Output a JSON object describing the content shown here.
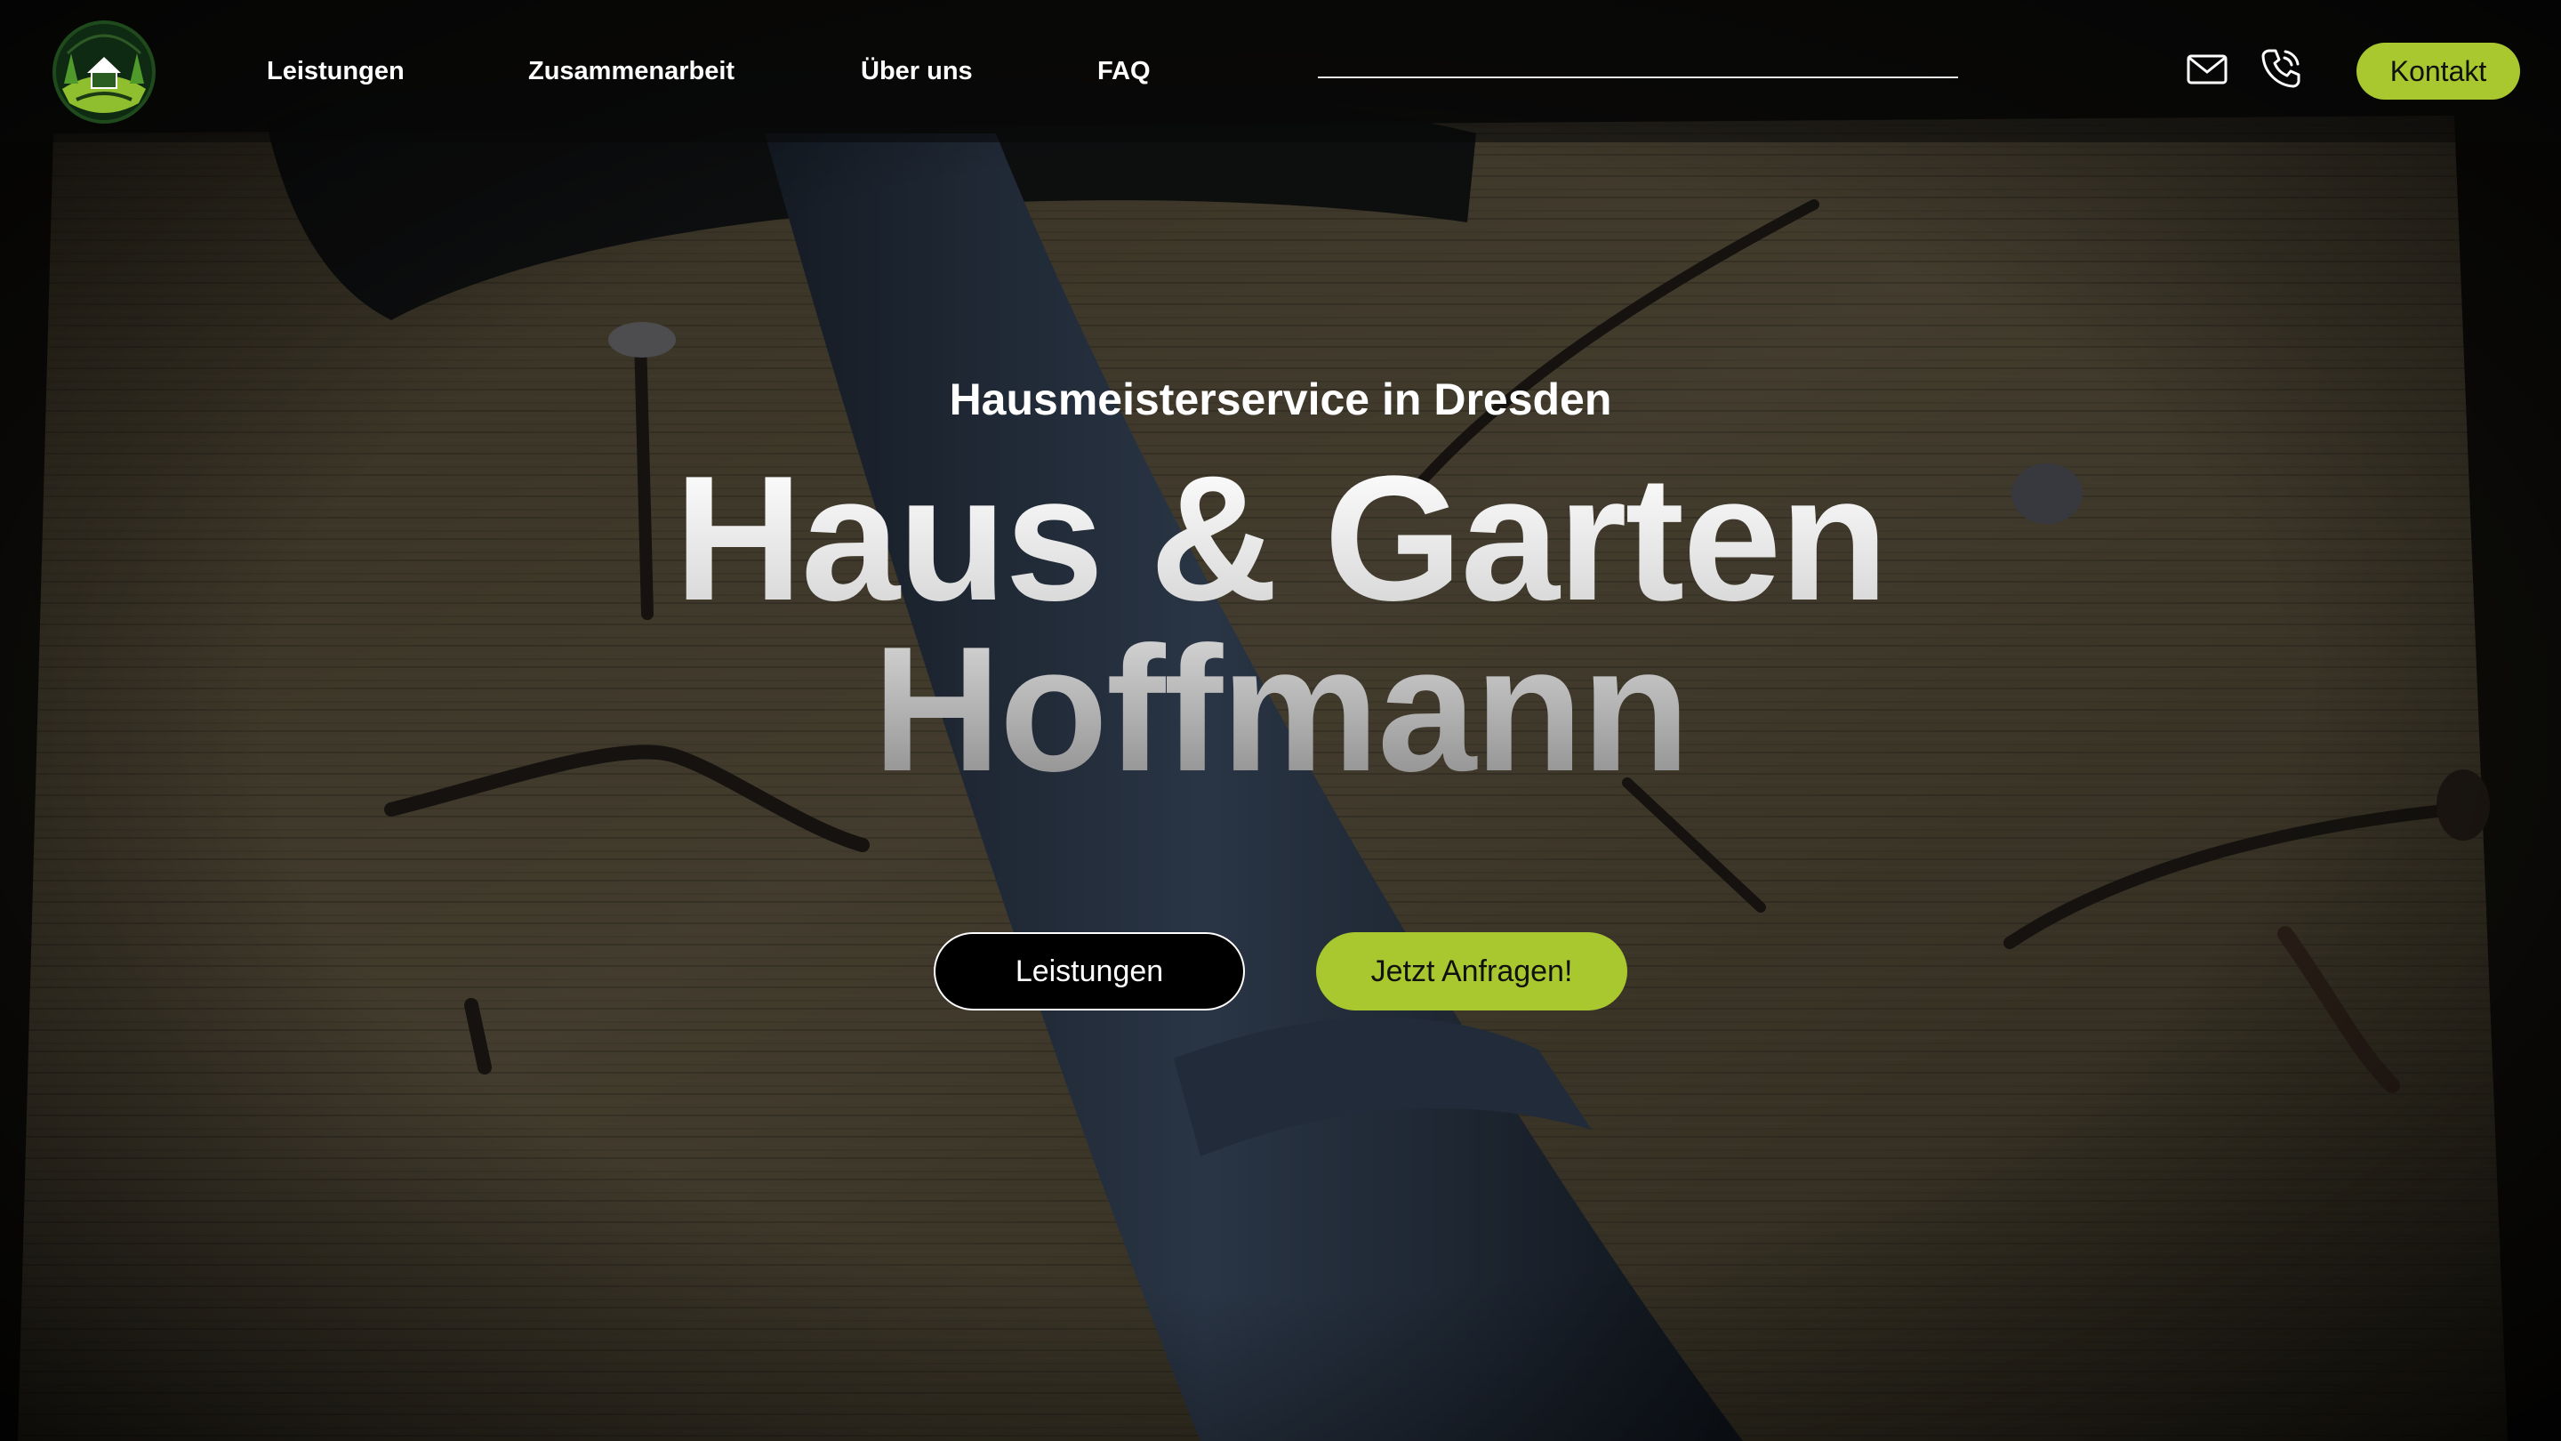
{
  "header": {
    "logo_icon": "house-garden-logo-icon",
    "nav": [
      {
        "label": "Leistungen"
      },
      {
        "label": "Zusammenarbeit"
      },
      {
        "label": "Über uns"
      },
      {
        "label": "FAQ"
      }
    ],
    "mail_icon": "mail-icon",
    "phone_icon": "phone-icon",
    "contact_label": "Kontakt"
  },
  "hero": {
    "background": "hammer-and-nails-on-wood-photo",
    "subtitle": "Hausmeisterservice in Dresden",
    "title_line1": "Haus & Garten",
    "title_line2": "Hoffmann",
    "primary_button": "Leistungen",
    "secondary_button": "Jetzt Anfragen!"
  },
  "colors": {
    "accent": "#a9c72e",
    "header_bg": "#080808",
    "text": "#ffffff"
  }
}
